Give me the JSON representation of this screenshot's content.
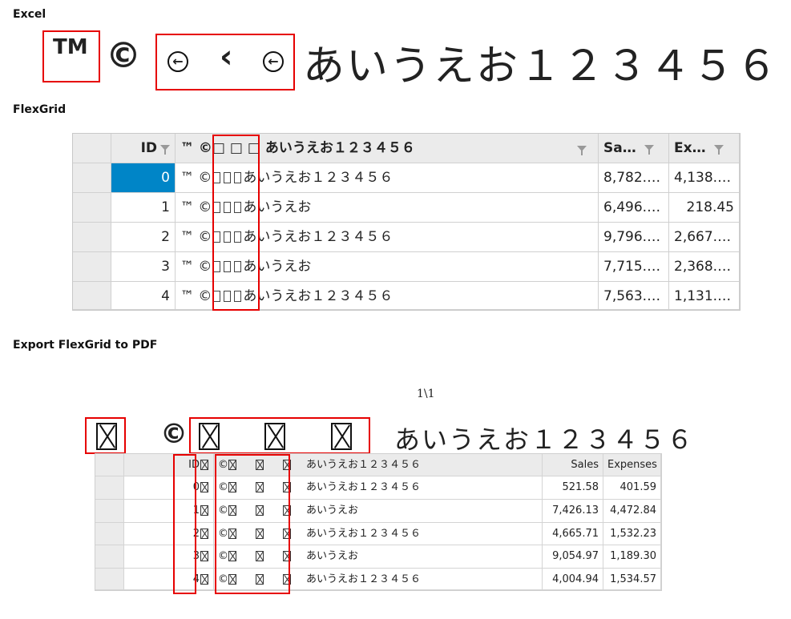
{
  "sections": {
    "excel": "Excel",
    "flexgrid": "FlexGrid",
    "export": "Export FlexGrid to PDF"
  },
  "excel": {
    "tm": "TM",
    "copyright": "©",
    "lt": "‹",
    "text": "あいうえお１２３４５６"
  },
  "flexgrid": {
    "headers": {
      "id": "ID",
      "name": "™ ©□ □ □ あいうえお１２３４５６",
      "sales": "Sa…",
      "expenses": "Ex…"
    },
    "rows": [
      {
        "id": "0",
        "prefix": "™ ©",
        "text": "あいうえお１２３４５６",
        "sales": "8,782.…",
        "expenses": "4,138.…"
      },
      {
        "id": "1",
        "prefix": "™ ©",
        "text": "あいうえお",
        "sales": "6,496.…",
        "expenses": "218.45"
      },
      {
        "id": "2",
        "prefix": "™ ©",
        "text": "あいうえお１２３４５６",
        "sales": "9,796.…",
        "expenses": "2,667.…"
      },
      {
        "id": "3",
        "prefix": "™ ©",
        "text": "あいうえお",
        "sales": "7,715.…",
        "expenses": "2,368.…"
      },
      {
        "id": "4",
        "prefix": "™ ©",
        "text": "あいうえお１２３４５６",
        "sales": "7,563.…",
        "expenses": "1,131.…"
      }
    ]
  },
  "pdf": {
    "page": "1\\1",
    "copyright": "©",
    "title_text": "あいうえお１２３４５６",
    "headers": {
      "id": "ID",
      "copy": "©",
      "name_text": "あいうえお１２３４５６",
      "sales": "Sales",
      "expenses": "Expenses"
    },
    "rows": [
      {
        "id": "0",
        "copy": "©",
        "text": "あいうえお１２３４５６",
        "sales": "521.58",
        "expenses": "401.59"
      },
      {
        "id": "1",
        "copy": "©",
        "text": "あいうえお",
        "sales": "7,426.13",
        "expenses": "4,472.84"
      },
      {
        "id": "2",
        "copy": "©",
        "text": "あいうえお１２３４５６",
        "sales": "4,665.71",
        "expenses": "1,532.23"
      },
      {
        "id": "3",
        "copy": "©",
        "text": "あいうえお",
        "sales": "9,054.97",
        "expenses": "1,189.30"
      },
      {
        "id": "4",
        "copy": "©",
        "text": "あいうえお１２３４５６",
        "sales": "4,004.94",
        "expenses": "1,534.57"
      }
    ]
  },
  "colors": {
    "highlight": "#e60000",
    "selection": "#0085c7"
  }
}
